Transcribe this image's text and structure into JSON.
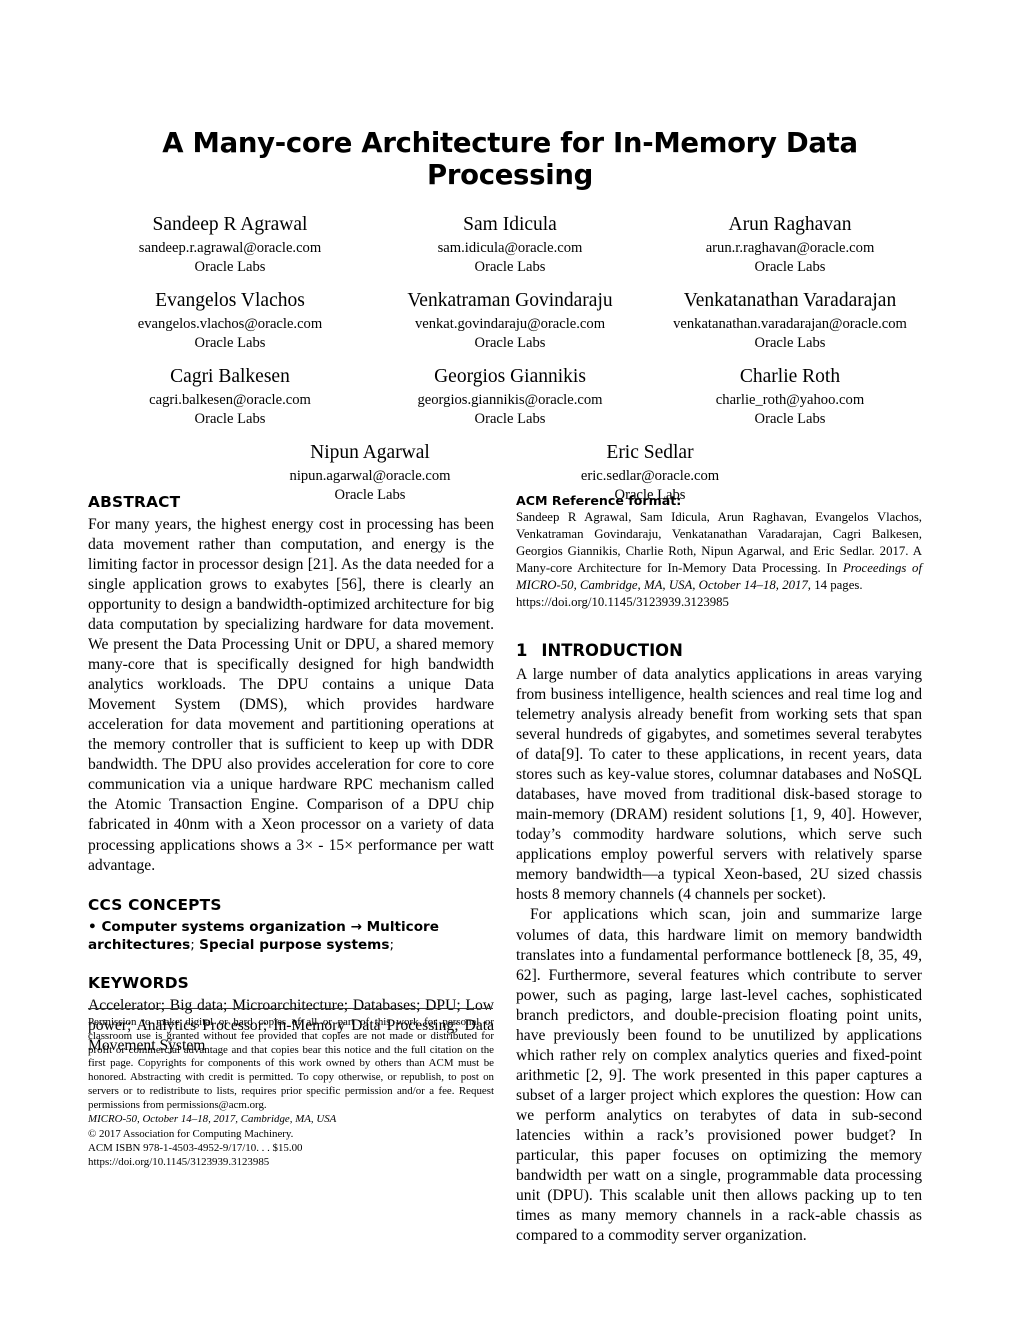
{
  "paper": {
    "title": "A Many-core Architecture for In-Memory Data Processing"
  },
  "authors": {
    "rows": [
      [
        {
          "name": "Sandeep R Agrawal",
          "email": "sandeep.r.agrawal@oracle.com",
          "affiliation": "Oracle Labs"
        },
        {
          "name": "Sam Idicula",
          "email": "sam.idicula@oracle.com",
          "affiliation": "Oracle Labs"
        },
        {
          "name": "Arun Raghavan",
          "email": "arun.r.raghavan@oracle.com",
          "affiliation": "Oracle Labs"
        }
      ],
      [
        {
          "name": "Evangelos Vlachos",
          "email": "evangelos.vlachos@oracle.com",
          "affiliation": "Oracle Labs"
        },
        {
          "name": "Venkatraman Govindaraju",
          "email": "venkat.govindaraju@oracle.com",
          "affiliation": "Oracle Labs"
        },
        {
          "name": "Venkatanathan Varadarajan",
          "email": "venkatanathan.varadarajan@oracle.com",
          "affiliation": "Oracle Labs"
        }
      ],
      [
        {
          "name": "Cagri Balkesen",
          "email": "cagri.balkesen@oracle.com",
          "affiliation": "Oracle Labs"
        },
        {
          "name": "Georgios Giannikis",
          "email": "georgios.giannikis@oracle.com",
          "affiliation": "Oracle Labs"
        },
        {
          "name": "Charlie Roth",
          "email": "charlie_roth@yahoo.com",
          "affiliation": "Oracle Labs"
        }
      ],
      [
        {
          "name": "Nipun Agarwal",
          "email": "nipun.agarwal@oracle.com",
          "affiliation": "Oracle Labs"
        },
        {
          "name": "Eric Sedlar",
          "email": "eric.sedlar@oracle.com",
          "affiliation": "Oracle Labs"
        }
      ]
    ]
  },
  "abstract": {
    "heading": "ABSTRACT",
    "text": "For many years, the highest energy cost in processing has been data movement rather than computation, and energy is the limiting factor in processor design [21]. As the data needed for a single application grows to exabytes [56], there is clearly an opportunity to design a bandwidth-optimized architecture for big data computation by specializing hardware for data movement. We present the Data Processing Unit or DPU, a shared memory many-core that is specifically designed for high bandwidth analytics workloads. The DPU contains a unique Data Movement System (DMS), which provides hardware acceleration for data movement and partitioning operations at the memory controller that is sufficient to keep up with DDR bandwidth. The DPU also provides acceleration for core to core communication via a unique hardware RPC mechanism called the Atomic Transaction Engine. Comparison of a DPU chip fabricated in 40nm with a Xeon processor on a variety of data processing applications shows a 3× - 15× performance per watt advantage."
  },
  "ccs_concepts": {
    "heading": "CCS CONCEPTS",
    "bullet": "•",
    "primary": "Computer systems organization",
    "arrow": "→",
    "secondary": "Multicore architectures",
    "separator_1": ";",
    "tertiary": "Special purpose systems",
    "separator_2": ";"
  },
  "keywords": {
    "heading": "KEYWORDS",
    "text": "Accelerator; Big data; Microarchitecture; Databases; DPU; Low power; Analytics Processor; In-Memory Data Processing; Data Movement System"
  },
  "acm_reference": {
    "heading": "ACM Reference format:",
    "line_1": "Sandeep R Agrawal, Sam Idicula, Arun Raghavan, Evangelos Vlachos, Venkatraman Govindaraju, Venkatanathan Varadarajan, Cagri Balkesen, Georgios Giannikis, Charlie Roth, Nipun Agarwal, and Eric Sedlar. 2017. A Many-core Architecture for In-Memory Data Processing. In ",
    "italic_1": "Proceedings of MICRO-50, Cambridge, MA, USA, October 14–18, 2017,",
    "line_2": " 14 pages.",
    "doi": "https://doi.org/10.1145/3123939.3123985"
  },
  "introduction": {
    "number": "1",
    "heading": "INTRODUCTION",
    "paragraph_1": "A large number of data analytics applications in areas varying from business intelligence, health sciences and real time log and telemetry analysis already benefit from working sets that span several hundreds of gigabytes, and sometimes several terabytes of data[9]. To cater to these applications, in recent years, data stores such as key-value stores, columnar databases and NoSQL databases, have moved from traditional disk-based storage to main-memory (DRAM) resident solutions [1, 9, 40]. However, today’s commodity hardware solutions, which serve such applications employ powerful servers with relatively sparse memory bandwidth—a typical Xeon-based, 2U sized chassis hosts 8 memory channels (4 channels per socket).",
    "paragraph_2": "For applications which scan, join and summarize large volumes of data, this hardware limit on memory bandwidth translates into a fundamental performance bottleneck [8, 35, 49, 62]. Furthermore, several features which contribute to server power, such as paging, large last-level caches, sophisticated branch predictors, and double-precision floating point units, have previously been found to be unutilized by applications which rather rely on complex analytics queries and fixed-point arithmetic [2, 9]. The work presented in this paper captures a subset of a larger project which explores the question: How can we perform analytics on terabytes of data in sub-second latencies within a rack’s provisioned power budget? In particular, this paper focuses on optimizing the memory bandwidth per watt on a single, programmable data processing unit (DPU). This scalable unit then allows packing up to ten times as many memory channels in a rack-able chassis as compared to a commodity server organization."
  },
  "footer": {
    "permission": "Permission to make digital or hard copies of all or part of this work for personal or classroom use is granted without fee provided that copies are not made or distributed for profit or commercial advantage and that copies bear this notice and the full citation on the first page. Copyrights for components of this work owned by others than ACM must be honored. Abstracting with credit is permitted. To copy otherwise, or republish, to post on servers or to redistribute to lists, requires prior specific permission and/or a fee. Request permissions from permissions@acm.org.",
    "conference": "MICRO-50, October 14–18, 2017, Cambridge, MA, USA",
    "copyright": "© 2017 Association for Computing Machinery.",
    "isbn": "ACM ISBN 978-1-4503-4952-9/17/10. . . $15.00",
    "doi": "https://doi.org/10.1145/3123939.3123985"
  }
}
